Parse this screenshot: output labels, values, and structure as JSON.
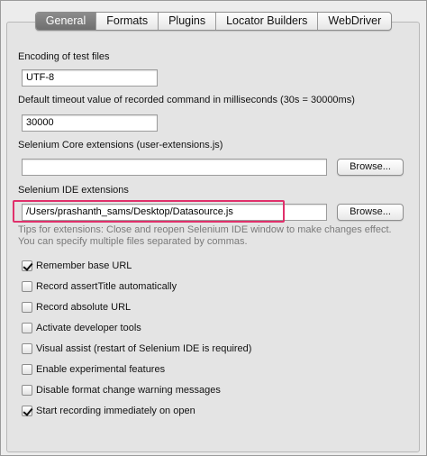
{
  "tabs": {
    "general": "General",
    "formats": "Formats",
    "plugins": "Plugins",
    "locator_builders": "Locator Builders",
    "webdriver": "WebDriver"
  },
  "encoding": {
    "label": "Encoding of test files",
    "value": "UTF-8"
  },
  "timeout": {
    "label": "Default timeout value of recorded command in milliseconds (30s = 30000ms)",
    "value": "30000"
  },
  "core_ext": {
    "label": "Selenium Core extensions (user-extensions.js)",
    "value": "",
    "browse": "Browse..."
  },
  "ide_ext": {
    "label": "Selenium IDE extensions",
    "value": "/Users/prashanth_sams/Desktop/Datasource.js",
    "browse": "Browse...",
    "tips_line1": "Tips for extensions: Close and reopen Selenium IDE window to make changes effect.",
    "tips_line2": "You can specify multiple files separated by commas.",
    "highlight_color": "#e0306b"
  },
  "options": [
    {
      "label": "Remember base URL",
      "checked": true
    },
    {
      "label": "Record assertTitle automatically",
      "checked": false
    },
    {
      "label": "Record absolute URL",
      "checked": false
    },
    {
      "label": "Activate developer tools",
      "checked": false
    },
    {
      "label": "Visual assist (restart of Selenium IDE is required)",
      "checked": false
    },
    {
      "label": "Enable experimental features",
      "checked": false
    },
    {
      "label": "Disable format change warning messages",
      "checked": false
    },
    {
      "label": "Start recording immediately on open",
      "checked": true
    }
  ]
}
